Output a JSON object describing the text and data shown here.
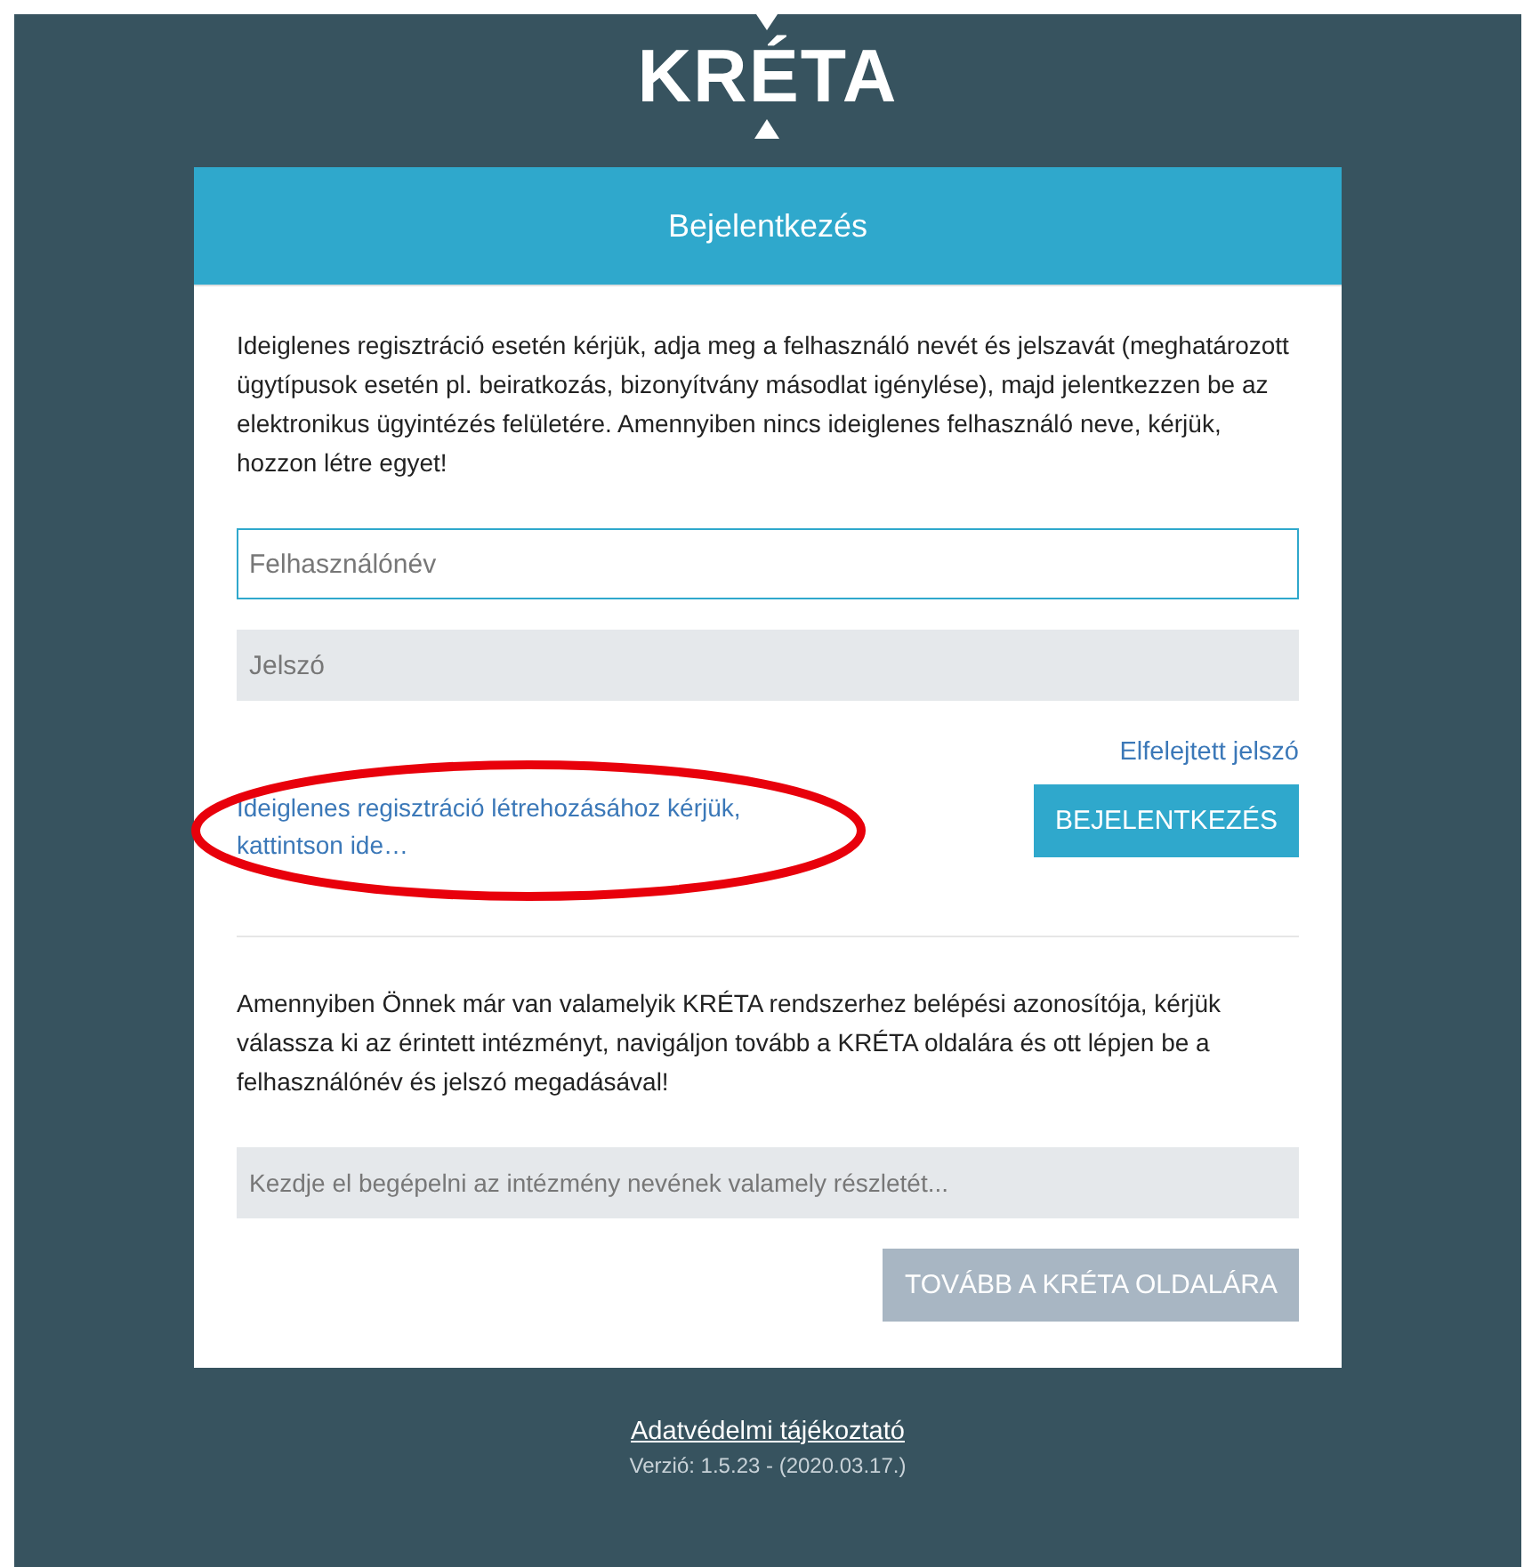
{
  "logo": {
    "text": "KRÉTA"
  },
  "card": {
    "title": "Bejelentkezés",
    "intro": "Ideiglenes regisztráció esetén kérjük, adja meg a felhasználó nevét és jelszavát (meghatározott ügytípusok esetén pl. beiratkozás, bizonyítvány másodlat igénylése), majd jelentkezzen be az elektronikus ügyintézés felületére. Amennyiben nincs ideiglenes felhasználó neve, kérjük, hozzon létre egyet!",
    "username": {
      "placeholder": "Felhasználónév",
      "focused": true
    },
    "password": {
      "placeholder": "Jelszó",
      "focused": false
    },
    "forgot_link": "Elfelejtett jelszó",
    "register_link": "Ideiglenes regisztráció létrehozásához kérjük, kattintson ide…",
    "register_highlighted": true,
    "login_button": {
      "label": "BEJELENTKEZÉS",
      "disabled": false
    },
    "kreta_info": "Amennyiben Önnek már van valamelyik KRÉTA rendszerhez belépési azonosítója, kérjük válassza ki az érintett intézményt, navigáljon tovább a KRÉTA oldalára és ott lépjen be a felhasználónév és jelszó megadásával!",
    "institution": {
      "placeholder": "Kezdje el begépelni az intézmény nevének valamely részletét...",
      "focused": false
    },
    "continue_button": {
      "label": "TOVÁBB A KRÉTA OLDALÁRA",
      "disabled": true
    }
  },
  "footer": {
    "privacy_link": "Adatvédelmi tájékoztató",
    "version": "Verzió: 1.5.23 - (2020.03.17.)"
  }
}
